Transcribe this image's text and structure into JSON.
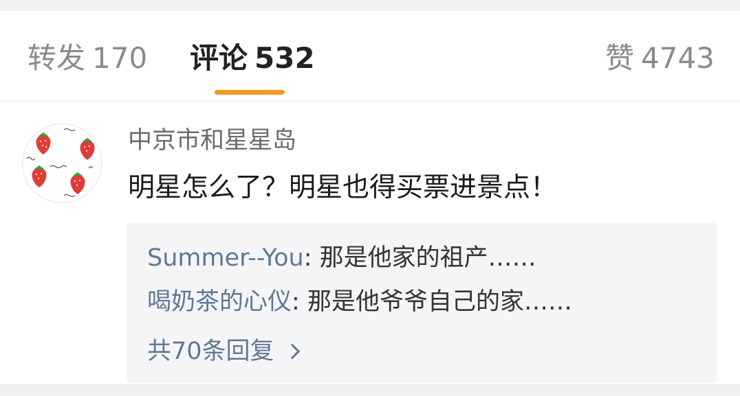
{
  "tabs": {
    "repost": {
      "label": "转发",
      "count": "170"
    },
    "comment": {
      "label": "评论",
      "count": "532"
    },
    "like": {
      "label": "赞",
      "count": "4743"
    },
    "active": "comment",
    "accent_color": "#f29a1d"
  },
  "comment": {
    "avatar_icon": "strawberry-pattern-avatar",
    "username": "中京市和星星岛",
    "text": "明星怎么了？明星也得买票进景点！",
    "replies": [
      {
        "author": "Summer--You",
        "separator": ": ",
        "text": "那是他家的祖产……"
      },
      {
        "author": "喝奶茶的心仪",
        "separator": ": ",
        "text": "那是他爷爷自己的家……"
      }
    ],
    "more_replies_label": "共70条回复",
    "link_color": "#5f7896"
  }
}
